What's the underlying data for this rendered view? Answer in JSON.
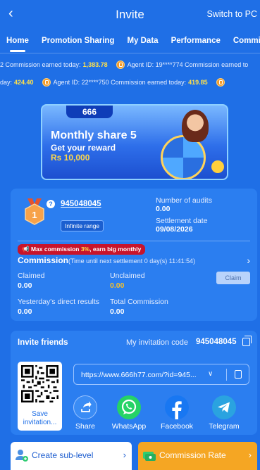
{
  "header": {
    "back_icon": "chevron-left-icon",
    "title": "Invite",
    "switch_label": "Switch to PC"
  },
  "tabs": [
    {
      "label": "Home",
      "active": true
    },
    {
      "label": "Promotion Sharing"
    },
    {
      "label": "My Data"
    },
    {
      "label": "Performance"
    },
    {
      "label": "Commission"
    }
  ],
  "ticker_row1": [
    {
      "text": "2 Commission earned today:",
      "value": "1,383.78"
    },
    {
      "text": "Agent ID: 19****774 Commission earned to",
      "value": ""
    }
  ],
  "ticker_row2": [
    {
      "text": "day:",
      "value": "424.40"
    },
    {
      "text": "Agent ID: 22****750 Commission earned today:",
      "value": "419.85"
    }
  ],
  "banner": {
    "logo": "666",
    "line1": "Monthly share 5",
    "line2": "Get your reward",
    "line3": "Rs 10,000"
  },
  "account": {
    "level": "1",
    "agent_id": "945048045",
    "range_badge": "Infinite range",
    "audits_label": "Number of audits",
    "audits_value": "0.00",
    "settlement_label": "Settlement date",
    "settlement_value": "09/08/2026"
  },
  "commission": {
    "promo_prefix": "Max commission ",
    "promo_highlight": "3%",
    "promo_suffix": ", earn big monthly",
    "title": "Commission",
    "subtitle": "(Time until next settlement  0 day(s) 11:41:54)",
    "claimed_label": "Claimed",
    "claimed_value": "0.00",
    "unclaimed_label": "Unclaimed",
    "unclaimed_value": "0.00",
    "claim_button": "Claim",
    "yesterday_label": "Yesterday's direct results",
    "yesterday_value": "0.00",
    "total_label": "Total Commission",
    "total_value": "0.00"
  },
  "invite": {
    "title": "Invite friends",
    "code_label": "My invitation code",
    "code": "945048045",
    "save_label_1": "Save",
    "save_label_2": "invitation...",
    "url": "https://www.666h77.com/?id=945..."
  },
  "share": [
    {
      "label": "Share",
      "icon": "share-icon",
      "color": "#2b7ef0"
    },
    {
      "label": "WhatsApp",
      "icon": "whatsapp-icon",
      "color": "#25d366"
    },
    {
      "label": "Facebook",
      "icon": "facebook-icon",
      "color": "#1877f2"
    },
    {
      "label": "Telegram",
      "icon": "telegram-icon",
      "color": "#2aa3e0"
    }
  ],
  "bottom": {
    "left_label": "Create sub-level",
    "right_label": "Commission Rate"
  }
}
